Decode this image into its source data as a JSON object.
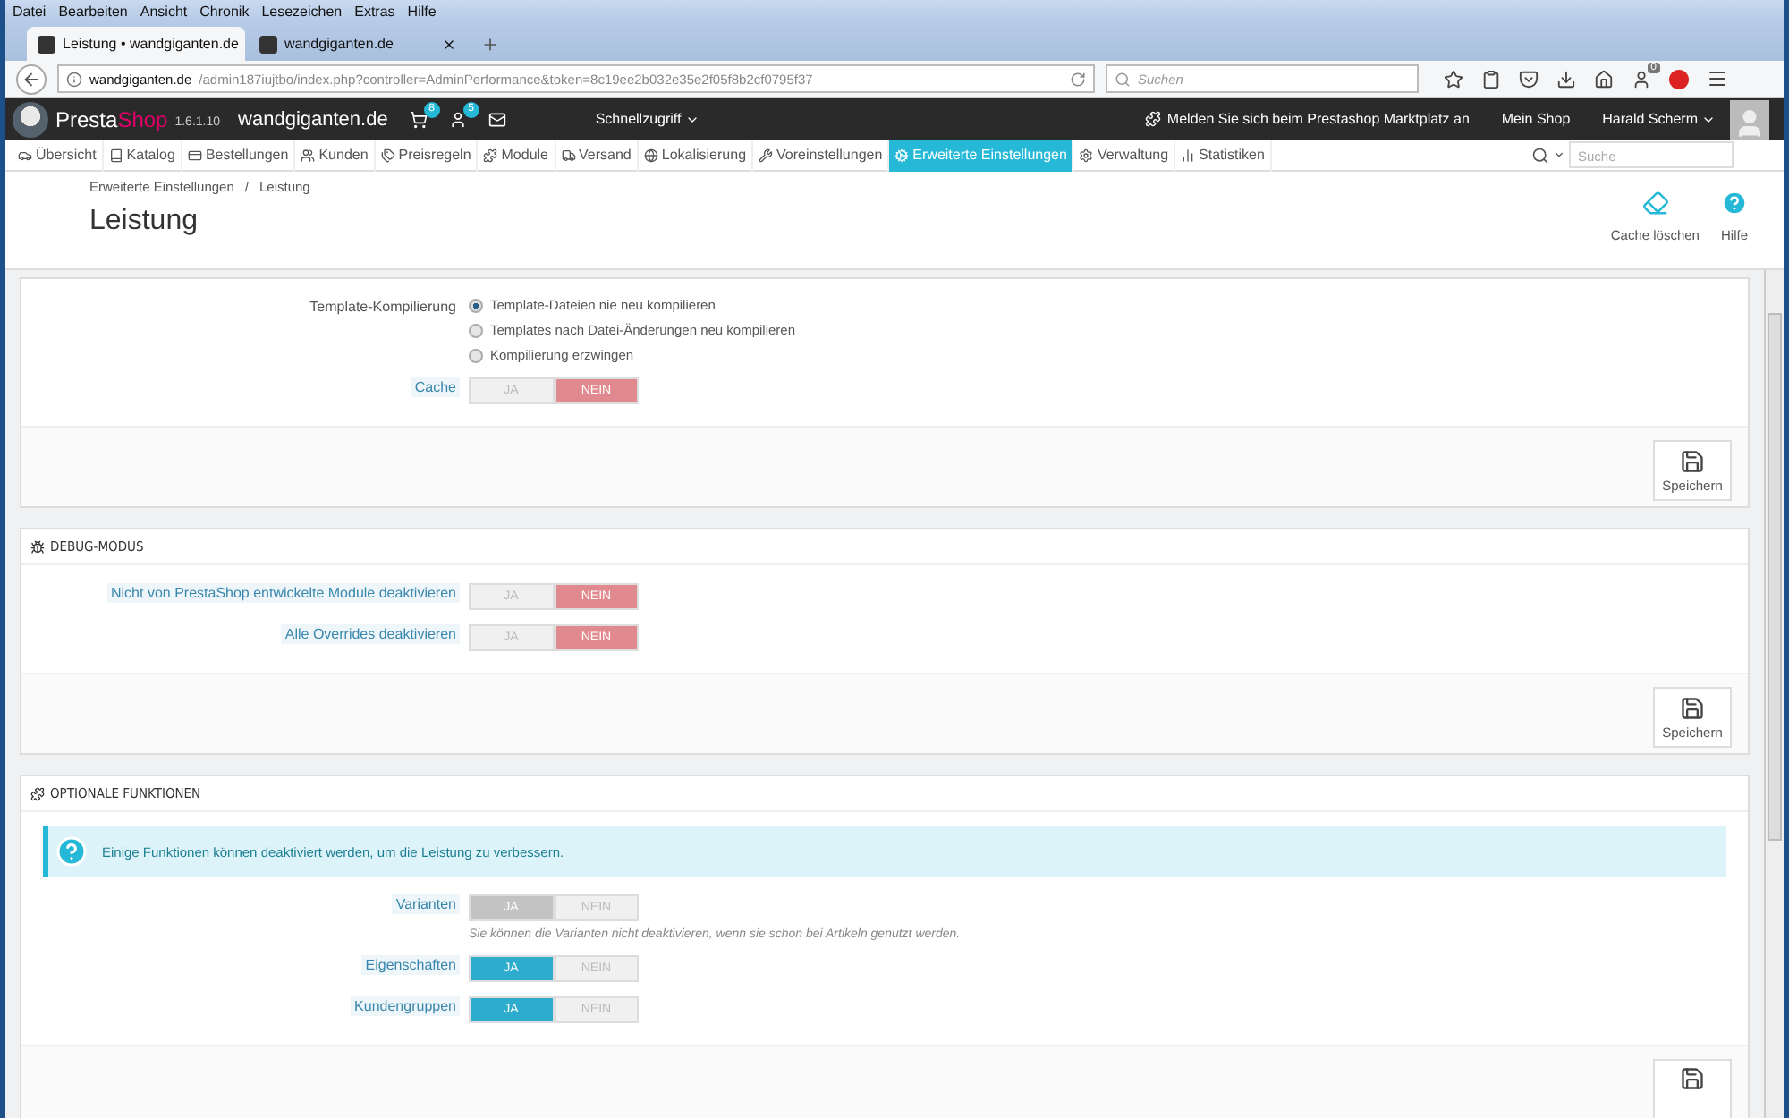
{
  "browser": {
    "menu": [
      "Datei",
      "Bearbeiten",
      "Ansicht",
      "Chronik",
      "Lesezeichen",
      "Extras",
      "Hilfe"
    ],
    "tabs": [
      {
        "title": "Leistung • wandgiganten.de",
        "selected": true
      },
      {
        "title": "wandgiganten.de",
        "selected": false
      }
    ],
    "url": {
      "host": "wandgiganten.de",
      "path": "/admin187iujtbo/index.php?controller=AdminPerformance&token=8c19ee2b032e35e2f05f8b2cf0795f37"
    },
    "search": {
      "placeholder": "Suchen"
    },
    "sync_badge": "0"
  },
  "header": {
    "brand_a": "Presta",
    "brand_b": "Shop",
    "version": "1.6.1.10",
    "shop": "wandgiganten.de",
    "cart_badge": "8",
    "customers_badge": "5",
    "quick_access": "Schnellzugriff",
    "marketplace": "Melden Sie sich beim Prestashop Marktplatz an",
    "my_shop": "Mein Shop",
    "user": "Harald Scherm"
  },
  "nav": {
    "items": [
      {
        "label": "Übersicht",
        "selected": false
      },
      {
        "label": "Katalog",
        "selected": false
      },
      {
        "label": "Bestellungen",
        "selected": false
      },
      {
        "label": "Kunden",
        "selected": false
      },
      {
        "label": "Preisregeln",
        "selected": false
      },
      {
        "label": "Module",
        "selected": false
      },
      {
        "label": "Versand",
        "selected": false
      },
      {
        "label": "Lokalisierung",
        "selected": false
      },
      {
        "label": "Voreinstellungen",
        "selected": false
      },
      {
        "label": "Erweiterte Einstellungen",
        "selected": true
      },
      {
        "label": "Verwaltung",
        "selected": false
      },
      {
        "label": "Statistiken",
        "selected": false
      }
    ],
    "search": {
      "placeholder": "Suche"
    }
  },
  "page": {
    "breadcrumb": [
      "Erweiterte Einstellungen",
      "Leistung"
    ],
    "breadcrumb_separator": "/",
    "title": "Leistung",
    "actions": [
      "Cache löschen",
      "Hilfe"
    ]
  },
  "panels": [
    {
      "fields": [
        {
          "kind": "radio",
          "label": "Template-Kompilierung",
          "options": [
            {
              "label": "Template-Dateien nie neu kompilieren",
              "selected": true
            },
            {
              "label": "Templates nach Datei-Änderungen neu kompilieren",
              "selected": false
            },
            {
              "label": "Kompilierung erzwingen",
              "selected": false
            }
          ]
        },
        {
          "kind": "toggle",
          "label": "Cache",
          "yes": "JA",
          "no": "NEIN",
          "on": false,
          "disabled": false
        }
      ],
      "save_button": {
        "kind": "full",
        "label": "Speichern"
      }
    },
    {
      "heading": "DEBUG-MODUS",
      "fields": [
        {
          "kind": "toggle",
          "label": "Nicht von PrestaShop entwickelte Module deaktivieren",
          "yes": "JA",
          "no": "NEIN",
          "on": false,
          "disabled": false
        },
        {
          "kind": "toggle",
          "label": "Alle Overrides deaktivieren",
          "yes": "JA",
          "no": "NEIN",
          "on": false,
          "disabled": false
        }
      ],
      "save_button": {
        "kind": "full",
        "label": "Speichern"
      }
    },
    {
      "heading": "OPTIONALE FUNKTIONEN",
      "alert": "Einige Funktionen können deaktiviert werden, um die Leistung zu verbessern.",
      "fields": [
        {
          "kind": "toggle",
          "label": "Varianten",
          "yes": "JA",
          "no": "NEIN",
          "on": true,
          "disabled": true,
          "help": "Sie können die Varianten nicht deaktivieren, wenn sie schon bei Artikeln genutzt werden."
        },
        {
          "kind": "toggle",
          "label": "Eigenschaften",
          "yes": "JA",
          "no": "NEIN",
          "on": true,
          "disabled": false
        },
        {
          "kind": "toggle",
          "label": "Kundengruppen",
          "yes": "JA",
          "no": "NEIN",
          "on": true,
          "disabled": false
        }
      ],
      "save_button": {
        "kind": "icon_only"
      }
    }
  ]
}
